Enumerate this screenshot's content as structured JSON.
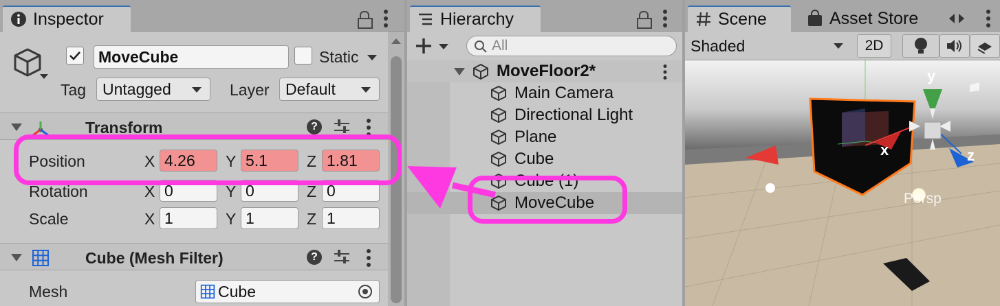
{
  "inspector": {
    "tab_label": "Inspector",
    "object_name": "MoveCube",
    "static_label": "Static",
    "tag_label": "Tag",
    "tag_value": "Untagged",
    "layer_label": "Layer",
    "layer_value": "Default",
    "transform": {
      "title": "Transform",
      "position_label": "Position",
      "rotation_label": "Rotation",
      "scale_label": "Scale",
      "axis_x": "X",
      "axis_y": "Y",
      "axis_z": "Z",
      "position": {
        "x": "4.26",
        "y": "5.1",
        "z": "1.81"
      },
      "rotation": {
        "x": "0",
        "y": "0",
        "z": "0"
      },
      "scale": {
        "x": "1",
        "y": "1",
        "z": "1"
      }
    },
    "mesh_filter": {
      "title": "Cube (Mesh Filter)",
      "mesh_label": "Mesh",
      "mesh_value": "Cube"
    }
  },
  "hierarchy": {
    "tab_label": "Hierarchy",
    "search_placeholder": "All",
    "scene_name": "MoveFloor2*",
    "items": [
      "Main Camera",
      "Directional Light",
      "Plane",
      "Cube",
      "Cube (1)",
      "MoveCube"
    ],
    "selected": "MoveCube"
  },
  "scene": {
    "tab_label": "Scene",
    "asset_store_label": "Asset Store",
    "shading_mode": "Shaded",
    "mode_2d_label": "2D",
    "gizmo_labels": {
      "x": "x",
      "y": "y",
      "z": "z"
    },
    "persp_label": "Persp"
  },
  "colors": {
    "highlight": "#ff39e2",
    "modified_field": "#f29292",
    "selection_outline": "#ff7a1a"
  }
}
